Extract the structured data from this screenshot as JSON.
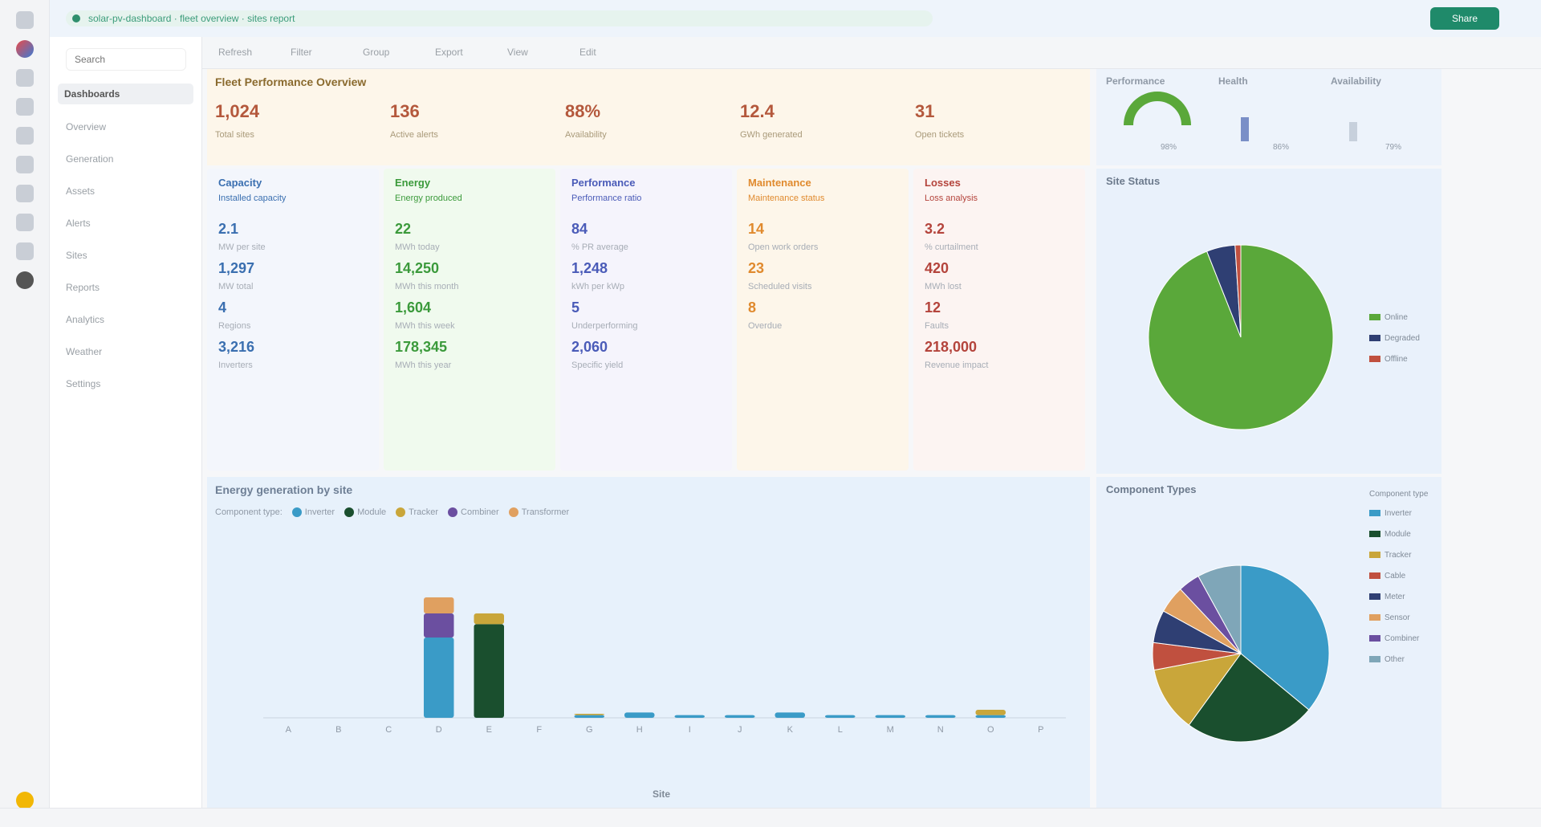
{
  "browser": {
    "url": "solar-pv-dashboard · fleet overview · sites report",
    "share_label": "Share"
  },
  "sidebar": {
    "search_placeholder": "Search",
    "section": "Dashboards",
    "items": [
      "Overview",
      "Generation",
      "Assets",
      "Alerts",
      "Sites",
      "Reports",
      "Analytics",
      "Weather",
      "Settings"
    ]
  },
  "toolbar": [
    "Refresh",
    "Filter",
    "Group",
    "Export",
    "View",
    "Edit"
  ],
  "kpi": {
    "title": "Fleet Performance Overview",
    "items": [
      {
        "value": "1,024",
        "label": "Total sites"
      },
      {
        "value": "136",
        "label": "Active alerts"
      },
      {
        "value": "88%",
        "label": "Availability"
      },
      {
        "value": "12.4",
        "label": "GWh generated"
      },
      {
        "value": "31",
        "label": "Open tickets"
      }
    ]
  },
  "gauges": {
    "items": [
      {
        "title": "Performance",
        "value": "98%"
      },
      {
        "title": "Health",
        "value": "86%"
      },
      {
        "title": "Availability",
        "value": "79%"
      }
    ]
  },
  "cards": [
    {
      "title": "Capacity",
      "subtitle": "Installed capacity",
      "color": "#3a6fb0",
      "bg": "#f3f6fc",
      "metrics": [
        {
          "v": "2.1",
          "l": "MW per site"
        },
        {
          "v": "1,297",
          "l": "MW total"
        },
        {
          "v": "4",
          "l": "Regions"
        },
        {
          "v": "3,216",
          "l": "Inverters"
        }
      ]
    },
    {
      "title": "Energy",
      "subtitle": "Energy produced",
      "color": "#3b9a3b",
      "bg": "#f0faee",
      "metrics": [
        {
          "v": "22",
          "l": "MWh today"
        },
        {
          "v": "14,250",
          "l": "MWh this month"
        },
        {
          "v": "1,604",
          "l": "MWh this week"
        },
        {
          "v": "178,345",
          "l": "MWh this year"
        }
      ]
    },
    {
      "title": "Performance",
      "subtitle": "Performance ratio",
      "color": "#4a5bb8",
      "bg": "#f5f4fc",
      "metrics": [
        {
          "v": "84",
          "l": "% PR average"
        },
        {
          "v": "1,248",
          "l": "kWh per kWp"
        },
        {
          "v": "5",
          "l": "Underperforming"
        },
        {
          "v": "2,060",
          "l": "Specific yield"
        }
      ]
    },
    {
      "title": "Maintenance",
      "subtitle": "Maintenance status",
      "color": "#e08a2e",
      "bg": "#fdf6ea",
      "metrics": [
        {
          "v": "14",
          "l": "Open work orders"
        },
        {
          "v": "23",
          "l": "Scheduled visits"
        },
        {
          "v": "8",
          "l": "Overdue"
        }
      ]
    },
    {
      "title": "Losses",
      "subtitle": "Loss analysis",
      "color": "#b4443c",
      "bg": "#fcf4f2",
      "metrics": [
        {
          "v": "3.2",
          "l": "% curtailment"
        },
        {
          "v": "420",
          "l": "MWh lost"
        },
        {
          "v": "12",
          "l": "Faults"
        },
        {
          "v": "218,000",
          "l": "Revenue impact"
        }
      ]
    }
  ],
  "site_status": {
    "title": "Site Status",
    "chart_data": {
      "type": "pie",
      "series": [
        {
          "name": "Online",
          "value": 94,
          "color": "#5aa83a"
        },
        {
          "name": "Degraded",
          "value": 5,
          "color": "#2f3f73"
        },
        {
          "name": "Offline",
          "value": 1,
          "color": "#c0503f"
        }
      ]
    }
  },
  "bottom_chart": {
    "title": "Energy generation by site",
    "filter_label": "Component type:",
    "xlabel": "Site",
    "chart_data": {
      "type": "bar",
      "categories": [
        "A",
        "B",
        "C",
        "D",
        "E",
        "F",
        "G",
        "H",
        "I",
        "J",
        "K",
        "L",
        "M",
        "N",
        "O",
        "P"
      ],
      "series": [
        {
          "name": "Inverter",
          "color": "#3a9bc7",
          "values": [
            0,
            0,
            0,
            60,
            0,
            0,
            2,
            4,
            2,
            2,
            4,
            2,
            2,
            2,
            2,
            0
          ]
        },
        {
          "name": "Module",
          "color": "#1a4f2e",
          "values": [
            0,
            0,
            0,
            0,
            70,
            0,
            0,
            0,
            0,
            0,
            0,
            0,
            0,
            0,
            0,
            0
          ]
        },
        {
          "name": "Tracker",
          "color": "#c9a63a",
          "values": [
            0,
            0,
            0,
            0,
            8,
            0,
            1,
            0,
            0,
            0,
            0,
            0,
            0,
            0,
            4,
            0
          ]
        },
        {
          "name": "Combiner",
          "color": "#6b4fa0",
          "values": [
            0,
            0,
            0,
            18,
            0,
            0,
            0,
            0,
            0,
            0,
            0,
            0,
            0,
            0,
            0,
            0
          ]
        },
        {
          "name": "Transformer",
          "color": "#e0a060",
          "values": [
            0,
            0,
            0,
            12,
            0,
            0,
            0,
            0,
            0,
            0,
            0,
            0,
            0,
            0,
            0,
            0
          ]
        }
      ],
      "ylim": [
        0,
        120
      ]
    }
  },
  "component_types": {
    "title": "Component Types",
    "legend_title": "Component type",
    "chart_data": {
      "type": "pie",
      "series": [
        {
          "name": "Inverter",
          "value": 36,
          "color": "#3a9bc7"
        },
        {
          "name": "Module",
          "value": 24,
          "color": "#1a4f2e"
        },
        {
          "name": "Tracker",
          "value": 12,
          "color": "#c9a63a"
        },
        {
          "name": "Cable",
          "value": 5,
          "color": "#c0503f"
        },
        {
          "name": "Meter",
          "value": 6,
          "color": "#2f3f73"
        },
        {
          "name": "Sensor",
          "value": 5,
          "color": "#e0a060"
        },
        {
          "name": "Combiner",
          "value": 4,
          "color": "#6b4fa0"
        },
        {
          "name": "Other",
          "value": 8,
          "color": "#7fa6b8"
        }
      ]
    }
  }
}
